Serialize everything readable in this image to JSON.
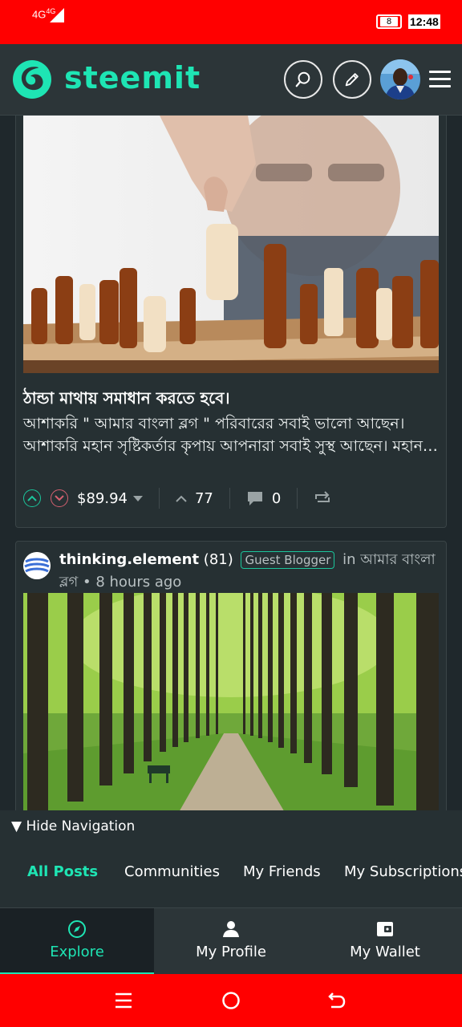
{
  "status_bar": {
    "signal": "4G",
    "signal_sup": "4G",
    "battery": "8",
    "time": "12:48"
  },
  "header": {
    "brand": "steemit",
    "brand_color": "#1ee5b4",
    "icons": [
      "search-icon",
      "pencil-icon",
      "avatar",
      "menu-icon"
    ]
  },
  "post1": {
    "title": "ঠান্ডা মাথায় সমাধান করতে হবে।",
    "excerpt": "আশাকরি \" আমার বাংলা ব্লগ \" পরিবারের সবাই ভালো আছেন। আশাকরি মহান সৃষ্টিকর্তার কৃপায় আপনারা সবাই সুস্থ আছেন। মহান…",
    "payout": "$89.94",
    "votes": "77",
    "comments": "0"
  },
  "post2": {
    "author": "thinking.element",
    "reputation": "(81)",
    "badge": "Guest Blogger",
    "in_text": "in",
    "community": "আমার বাংলা ব্লগ",
    "time": "• 8 hours ago"
  },
  "nav": {
    "hide_label": "Hide Navigation",
    "tabs": [
      "All Posts",
      "Communities",
      "My Friends",
      "My Subscriptions"
    ],
    "active_tab": "All Posts"
  },
  "bottom_nav": {
    "explore": "Explore",
    "profile": "My Profile",
    "wallet": "My Wallet"
  },
  "colors": {
    "accent": "#1ee5b4",
    "background": "#1f282c",
    "system_bar": "#ff0000"
  }
}
